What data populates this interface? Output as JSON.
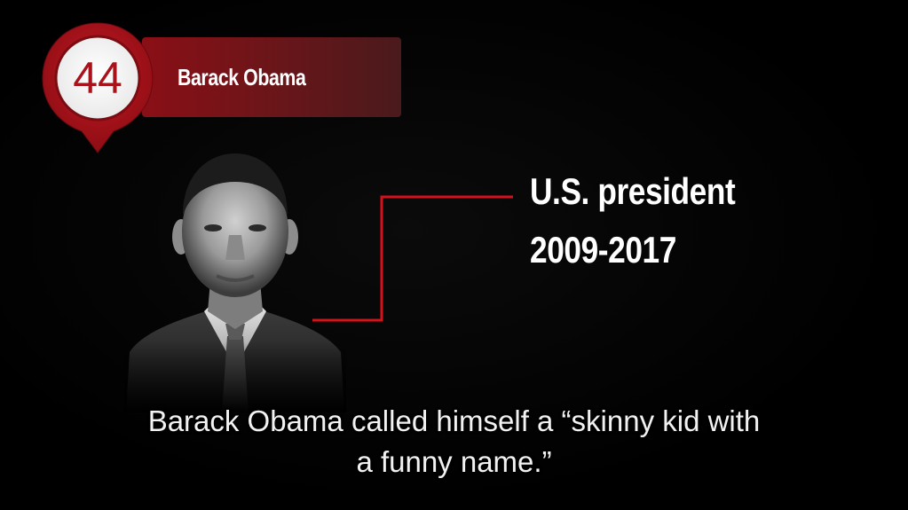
{
  "badge": {
    "number": "44",
    "name": "Barack Obama",
    "accent_color": "#a8121b"
  },
  "info": {
    "role": "U.S. president",
    "years": "2009-2017",
    "connector_color": "#d4111d"
  },
  "subtitle": {
    "line1": "Barack Obama called himself a “skinny kid with",
    "line2": "a funny name.”"
  },
  "portrait": {
    "icon": "person-portrait"
  }
}
